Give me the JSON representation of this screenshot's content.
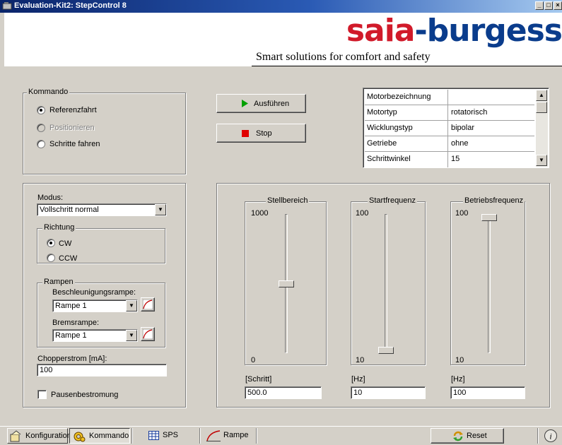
{
  "window": {
    "title": "Evaluation-Kit2: StepControl 8"
  },
  "header": {
    "logo_saia": "saia",
    "logo_dash": "-",
    "logo_burgess": "burgess",
    "tagline": "Smart solutions for comfort and safety"
  },
  "kommando": {
    "label": "Kommando",
    "options": [
      {
        "label": "Referenzfahrt",
        "checked": true,
        "disabled": false
      },
      {
        "label": "Positionieren",
        "checked": false,
        "disabled": true
      },
      {
        "label": "Schritte fahren",
        "checked": false,
        "disabled": false
      }
    ]
  },
  "actions": {
    "run_label": "Ausführen",
    "stop_label": "Stop"
  },
  "motor_table": {
    "rows": [
      [
        "Motorbezeichnung",
        ""
      ],
      [
        "Motortyp",
        "rotatorisch"
      ],
      [
        "Wicklungstyp",
        "bipolar"
      ],
      [
        "Getriebe",
        "ohne"
      ],
      [
        "Schrittwinkel",
        "15"
      ]
    ]
  },
  "modus": {
    "label": "Modus:",
    "value": "Vollschritt normal",
    "richtung": {
      "label": "Richtung",
      "options": [
        {
          "label": "CW",
          "checked": true
        },
        {
          "label": "CCW",
          "checked": false
        }
      ]
    },
    "rampen": {
      "label": "Rampen",
      "accel_label": "Beschleunigungsrampe:",
      "accel_value": "Rampe 1",
      "brake_label": "Bremsrampe:",
      "brake_value": "Rampe 1"
    },
    "chopper_label": "Chopperstrom [mA]:",
    "chopper_value": "100",
    "pause_label": "Pausenbestromung",
    "pause_checked": false
  },
  "sliders": [
    {
      "label": "Stellbereich",
      "max": "1000",
      "min": "0",
      "unit": "[Schritt]",
      "value": "500.0",
      "fraction": 0.5
    },
    {
      "label": "Startfrequenz",
      "max": "100",
      "min": "10",
      "unit": "[Hz]",
      "value": "10",
      "fraction": 0.0
    },
    {
      "label": "Betriebsfrequenz",
      "max": "100",
      "min": "10",
      "unit": "[Hz]",
      "value": "100",
      "fraction": 1.0
    }
  ],
  "tabs": {
    "konfiguration": "Konfiguration",
    "kommando": "Kommando",
    "sps": "SPS",
    "rampe": "Rampe",
    "reset": "Reset"
  },
  "colors": {
    "titlebar": "#0a246a",
    "logo_red": "#d11a2a",
    "logo_blue": "#0a3c8c",
    "run_green": "#00a000",
    "stop_red": "#e00000"
  }
}
